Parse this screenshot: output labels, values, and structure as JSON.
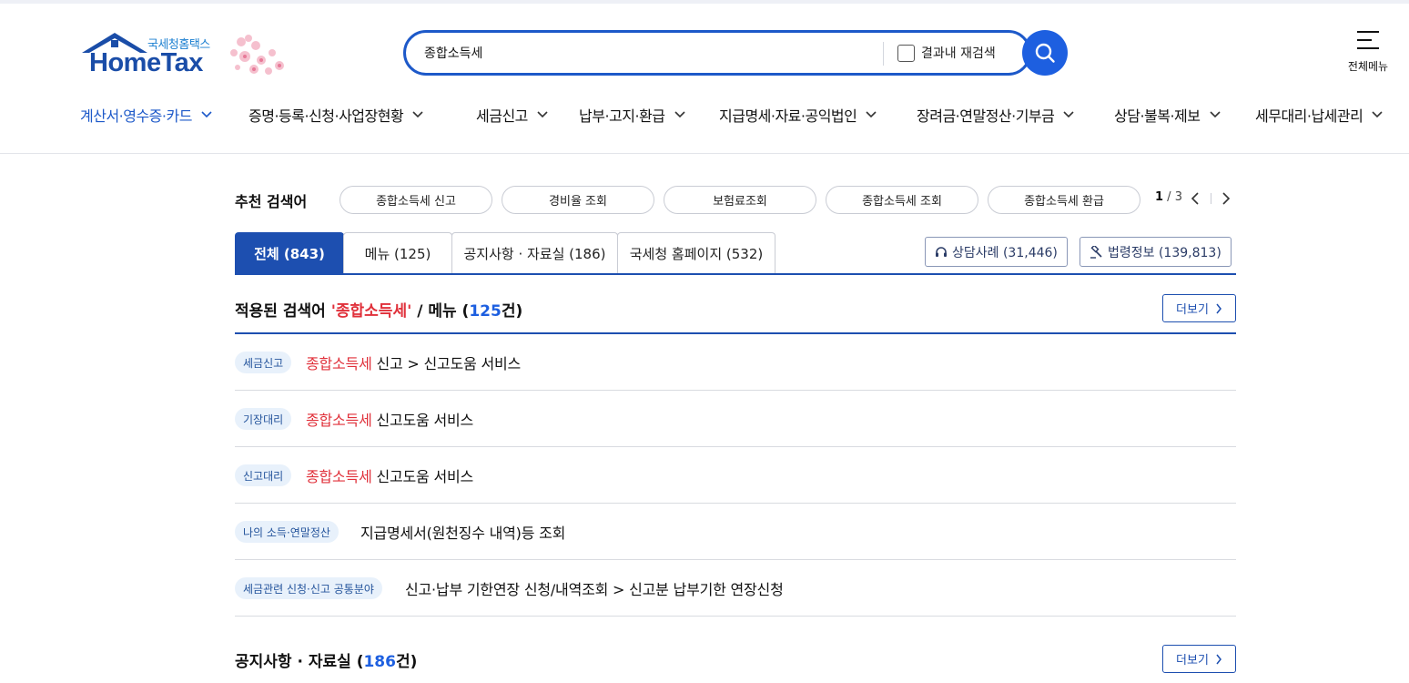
{
  "header": {
    "logo_sub": "국세청홈택스",
    "logo_main": "HomeTax",
    "search_value": "종합소득세",
    "research_label": "결과내 재검색",
    "all_menu_label": "전체메뉴"
  },
  "gnb": [
    {
      "label": "계산서·영수증·카드",
      "active": true
    },
    {
      "label": "증명·등록·신청·사업장현황"
    },
    {
      "label": "세금신고"
    },
    {
      "label": "납부·고지·환급"
    },
    {
      "label": "지급명세·자료·공익법인"
    },
    {
      "label": "장려금·연말정산·기부금"
    },
    {
      "label": "상담·불복·제보"
    },
    {
      "label": "세무대리·납세관리"
    }
  ],
  "recommend": {
    "label": "추천 검색어",
    "chips": [
      "종합소득세 신고",
      "경비율 조회",
      "보험료조회",
      "종합소득세 조회",
      "종합소득세 환급"
    ],
    "page_current": "1",
    "page_total": "3"
  },
  "tabs": [
    {
      "label": "전체 (843)",
      "active": true
    },
    {
      "label": "메뉴 (125)"
    },
    {
      "label": "공지사항 · 자료실 (186)"
    },
    {
      "label": "국세청 홈페이지 (532)"
    }
  ],
  "side_buttons": {
    "consult": "상담사례 (31,446)",
    "law": "법령정보 (139,813)"
  },
  "menu_section": {
    "prefix": "적용된 검색어 ",
    "keyword": "'종합소득세'",
    "middle": " / 메뉴 (",
    "count": "125",
    "suffix": "건)",
    "more_label": "더보기"
  },
  "results": [
    {
      "badge": "세금신고",
      "highlight": "종합소득세",
      "rest": " 신고 > 신고도움 서비스"
    },
    {
      "badge": "기장대리",
      "highlight": "종합소득세",
      "rest": " 신고도움 서비스"
    },
    {
      "badge": "신고대리",
      "highlight": "종합소득세",
      "rest": " 신고도움 서비스"
    },
    {
      "badge": "나의 소득·연말정산",
      "highlight": "",
      "rest": "지급명세서(원천징수 내역)등 조회"
    },
    {
      "badge": "세금관련 신청·신고 공통분야",
      "highlight": "",
      "rest": "신고·납부 기한연장 신청/내역조회 > 신고분 납부기한 연장신청"
    }
  ],
  "notice_section": {
    "prefix": "공지사항 · 자료실 (",
    "count": "186",
    "suffix": "건)",
    "more_label": "더보기"
  },
  "colors": {
    "brand_blue": "#1d4fb0",
    "accent_blue": "#1d5fe0",
    "highlight_red": "#e0303a",
    "badge_bg": "#e8f1fb"
  }
}
